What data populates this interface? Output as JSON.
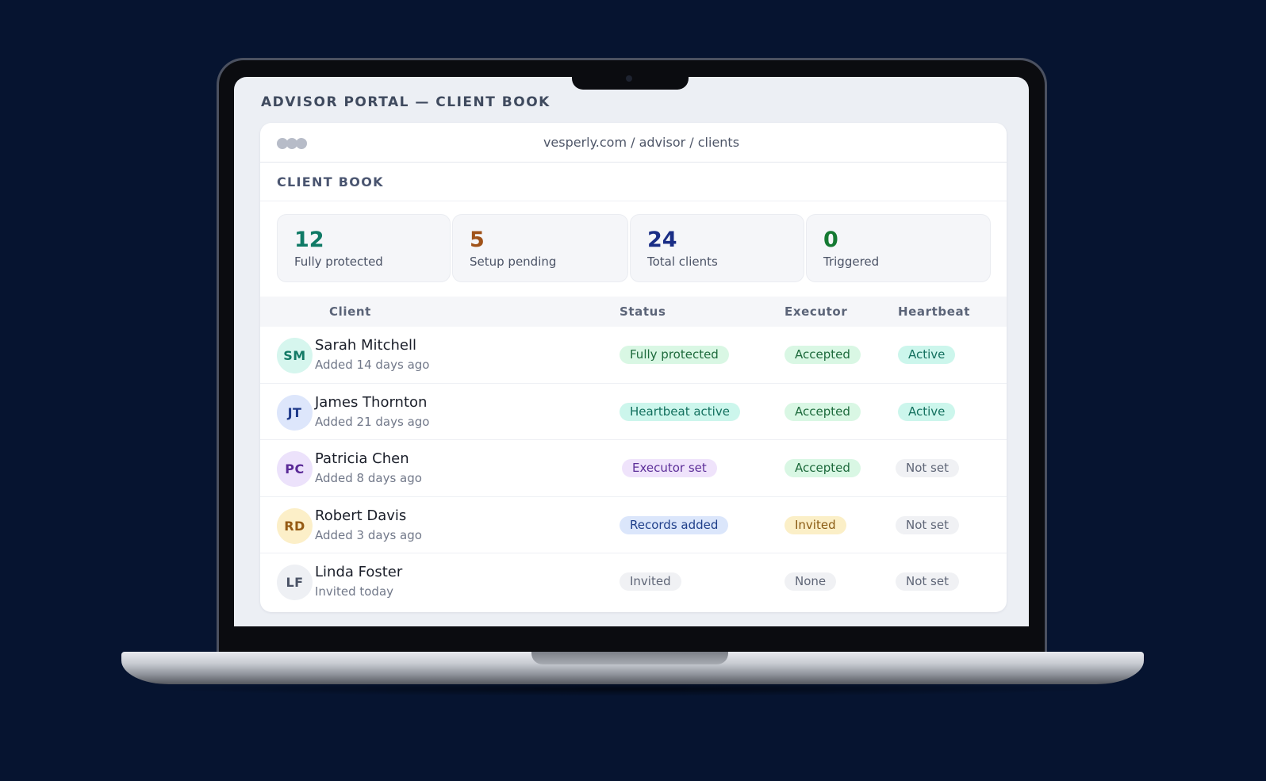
{
  "portal_title": "ADVISOR PORTAL — CLIENT BOOK",
  "browser": {
    "url": "vesperly.com / advisor / clients"
  },
  "section_title": "CLIENT BOOK",
  "stats": [
    {
      "value": "12",
      "label": "Fully protected",
      "color": "#0f7a66"
    },
    {
      "value": "5",
      "label": "Setup pending",
      "color": "#a0531a"
    },
    {
      "value": "24",
      "label": "Total clients",
      "color": "#1a2e86"
    },
    {
      "value": "0",
      "label": "Triggered",
      "color": "#157a33"
    }
  ],
  "table": {
    "columns": {
      "client": "Client",
      "status": "Status",
      "executor": "Executor",
      "heartbeat": "Heartbeat"
    },
    "rows": [
      {
        "initials": "SM",
        "name": "Sarah Mitchell",
        "added": "Added 14 days ago",
        "status": "Fully protected",
        "executor": "Accepted",
        "heartbeat": "Active"
      },
      {
        "initials": "JT",
        "name": "James Thornton",
        "added": "Added 21 days ago",
        "status": "Heartbeat active",
        "executor": "Accepted",
        "heartbeat": "Active"
      },
      {
        "initials": "PC",
        "name": "Patricia Chen",
        "added": "Added 8 days ago",
        "status": "Executor set",
        "executor": "Accepted",
        "heartbeat": "Not set"
      },
      {
        "initials": "RD",
        "name": "Robert Davis",
        "added": "Added 3 days ago",
        "status": "Records added",
        "executor": "Invited",
        "heartbeat": "Not set"
      },
      {
        "initials": "LF",
        "name": "Linda Foster",
        "added": "Invited today",
        "status": "Invited",
        "executor": "None",
        "heartbeat": "Not set"
      }
    ]
  },
  "colors": {
    "background": "#061430",
    "screen": "#eceff4",
    "avatar_sm": "#d6f6ee",
    "avatar_jt": "#dde6fb",
    "avatar_pc": "#ece2fb",
    "avatar_rd": "#fcefc8",
    "avatar_lf": "#eef0f4"
  }
}
